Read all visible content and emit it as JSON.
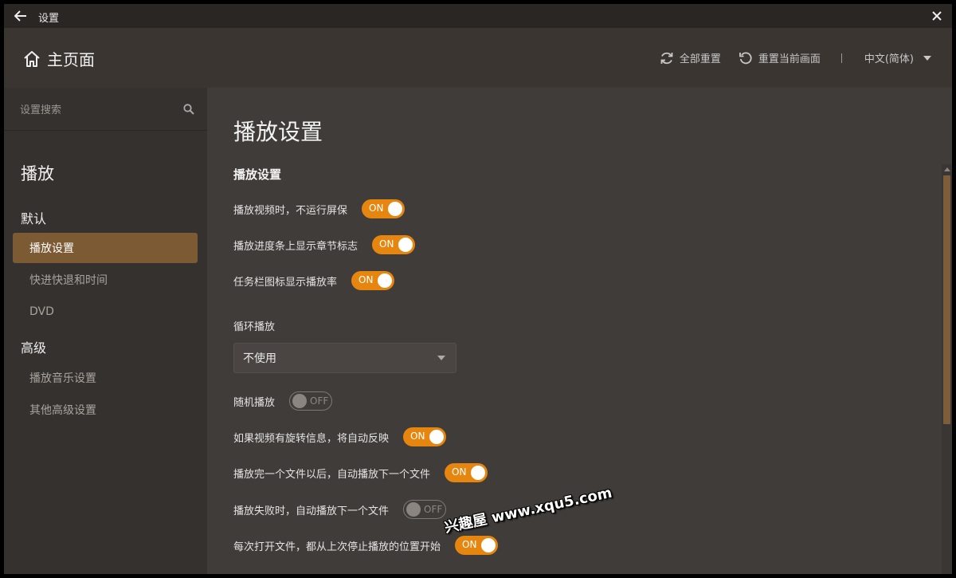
{
  "titlebar": {
    "title": "设置"
  },
  "header": {
    "home_label": "主页面",
    "reset_all": "全部重置",
    "reset_current": "重置当前画面",
    "language": "中文(简体)"
  },
  "sidebar": {
    "search_placeholder": "设置搜索",
    "section": "播放",
    "groups": [
      {
        "title": "默认",
        "items": [
          "播放设置",
          "快进快退和时间",
          "DVD"
        ]
      },
      {
        "title": "高级",
        "items": [
          "播放音乐设置",
          "其他高级设置"
        ]
      }
    ],
    "active_item": "播放设置"
  },
  "content": {
    "page_title": "播放设置",
    "section_title": "播放设置",
    "settings": [
      {
        "label": "播放视频时，不运行屏保",
        "state": "ON"
      },
      {
        "label": "播放进度条上显示章节标志",
        "state": "ON"
      },
      {
        "label": "任务栏图标显示播放率",
        "state": "ON"
      },
      {
        "label": "随机播放",
        "state": "OFF"
      },
      {
        "label": "如果视频有旋转信息，将自动反映",
        "state": "ON"
      },
      {
        "label": "播放完一个文件以后，自动播放下一个文件",
        "state": "ON"
      },
      {
        "label": "播放失败时，自动播放下一个文件",
        "state": "OFF"
      },
      {
        "label": "每次打开文件，都从上次停止播放的位置开始",
        "state": "ON"
      }
    ],
    "loop": {
      "label": "循环播放",
      "value": "不使用"
    }
  },
  "watermark": "兴趣屋 www.xqu5.com",
  "colors": {
    "accent": "#e6860f",
    "active_nav": "#7c5a34"
  }
}
